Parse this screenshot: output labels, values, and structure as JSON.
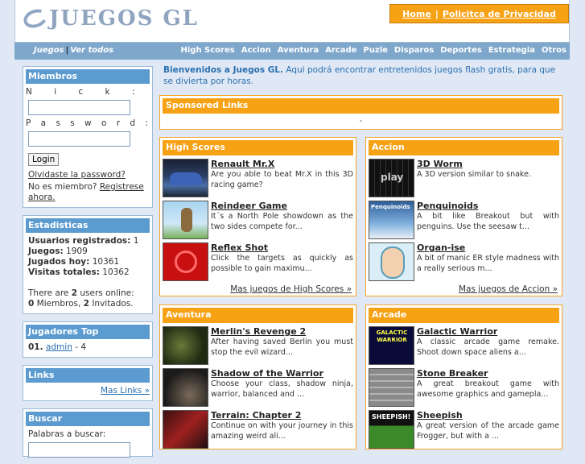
{
  "site": {
    "logo_text": "JUEGOS GL",
    "toplinks": [
      "Home",
      "Policitca de Privacidad"
    ],
    "toplinks_sep": "|"
  },
  "nav": {
    "left": [
      "Juegos",
      "Ver todos"
    ],
    "left_sep": "|",
    "right": [
      "High Scores",
      "Accion",
      "Aventura",
      "Arcade",
      "Puzle",
      "Disparos",
      "Deportes",
      "Estrategia",
      "Otros"
    ]
  },
  "miembros": {
    "title": "Miembros",
    "nick_label": "N i c k :",
    "password_label": "P a s s w o r d :",
    "login": "Login",
    "forgot": "Olvidaste la password?",
    "not_member": "No es miembro?",
    "register": "Registrese ahora."
  },
  "estadisticas": {
    "title": "Estadisticas",
    "rows": [
      {
        "label": "Usuarios registrados:",
        "value": "1"
      },
      {
        "label": "Juegos:",
        "value": "1909"
      },
      {
        "label": "Jugados hoy:",
        "value": "10361"
      },
      {
        "label": "Visitas totales:",
        "value": "10362"
      }
    ],
    "online_pre": "There are",
    "online_count": "2",
    "online_post": "users online:",
    "members_count": "0",
    "members_label": "Miembros,",
    "guests_count": "2",
    "guests_label": "Invitados."
  },
  "top": {
    "title": "Jugadores Top",
    "rank": "01.",
    "player": "admin",
    "score": "- 4"
  },
  "links": {
    "title": "Links",
    "more": "Mas Links »"
  },
  "buscar": {
    "title": "Buscar",
    "label": "Palabras a buscar:"
  },
  "welcome": {
    "bold": "Bienvenidos a Juegos GL.",
    "text": "Aqui podrá encontrar entretenidos juegos flash gratis, para que se divierta por horas."
  },
  "sponsored": {
    "title": "Sponsored Links",
    "content": "-"
  },
  "sections": [
    {
      "title": "High Scores",
      "more": "Mas juegos de High Scores »",
      "games": [
        {
          "title": "Renault Mr.X",
          "desc": "Are you able to beat Mr.X in this 3D racing game?"
        },
        {
          "title": "Reindeer Game",
          "desc": "It´s a North Pole showdown as the two sides compete for..."
        },
        {
          "title": "Reflex Shot",
          "desc": "Click the targets as quickly as possible to gain maximu..."
        }
      ]
    },
    {
      "title": "Accion",
      "more": "Mas juegos de Accion »",
      "games": [
        {
          "title": "3D Worm",
          "desc": "A 3D version similar to snake."
        },
        {
          "title": "Penquinoids",
          "desc": "A bit like Breakout but with penguins. Use the seesaw t..."
        },
        {
          "title": "Organ-ise",
          "desc": "A bit of manic ER style madness with a really serious m..."
        }
      ]
    },
    {
      "title": "Aventura",
      "more": "",
      "games": [
        {
          "title": "Merlin's Revenge 2",
          "desc": "After having saved Berlin you must stop the evil wizard..."
        },
        {
          "title": "Shadow of the Warrior",
          "desc": "Choose your class, shadow ninja, warrior, balanced and ..."
        },
        {
          "title": "Terrain: Chapter 2",
          "desc": "Continue on with your journey in this amazing weird ali..."
        }
      ]
    },
    {
      "title": "Arcade",
      "more": "",
      "games": [
        {
          "title": "Galactic Warrior",
          "desc": "A classic arcade game remake. Shoot down space aliens a..."
        },
        {
          "title": "Stone Breaker",
          "desc": "A great breakout game with awesome graphics and gamepla..."
        },
        {
          "title": "Sheepish",
          "desc": "A great version of the arcade game Frogger, but with a ..."
        }
      ]
    }
  ],
  "thumb_text": {
    "worm": "play",
    "peng": "Penquinoids",
    "galactic": "GALACTIC WARRIOR",
    "sheep": "SHEEPISH!"
  }
}
